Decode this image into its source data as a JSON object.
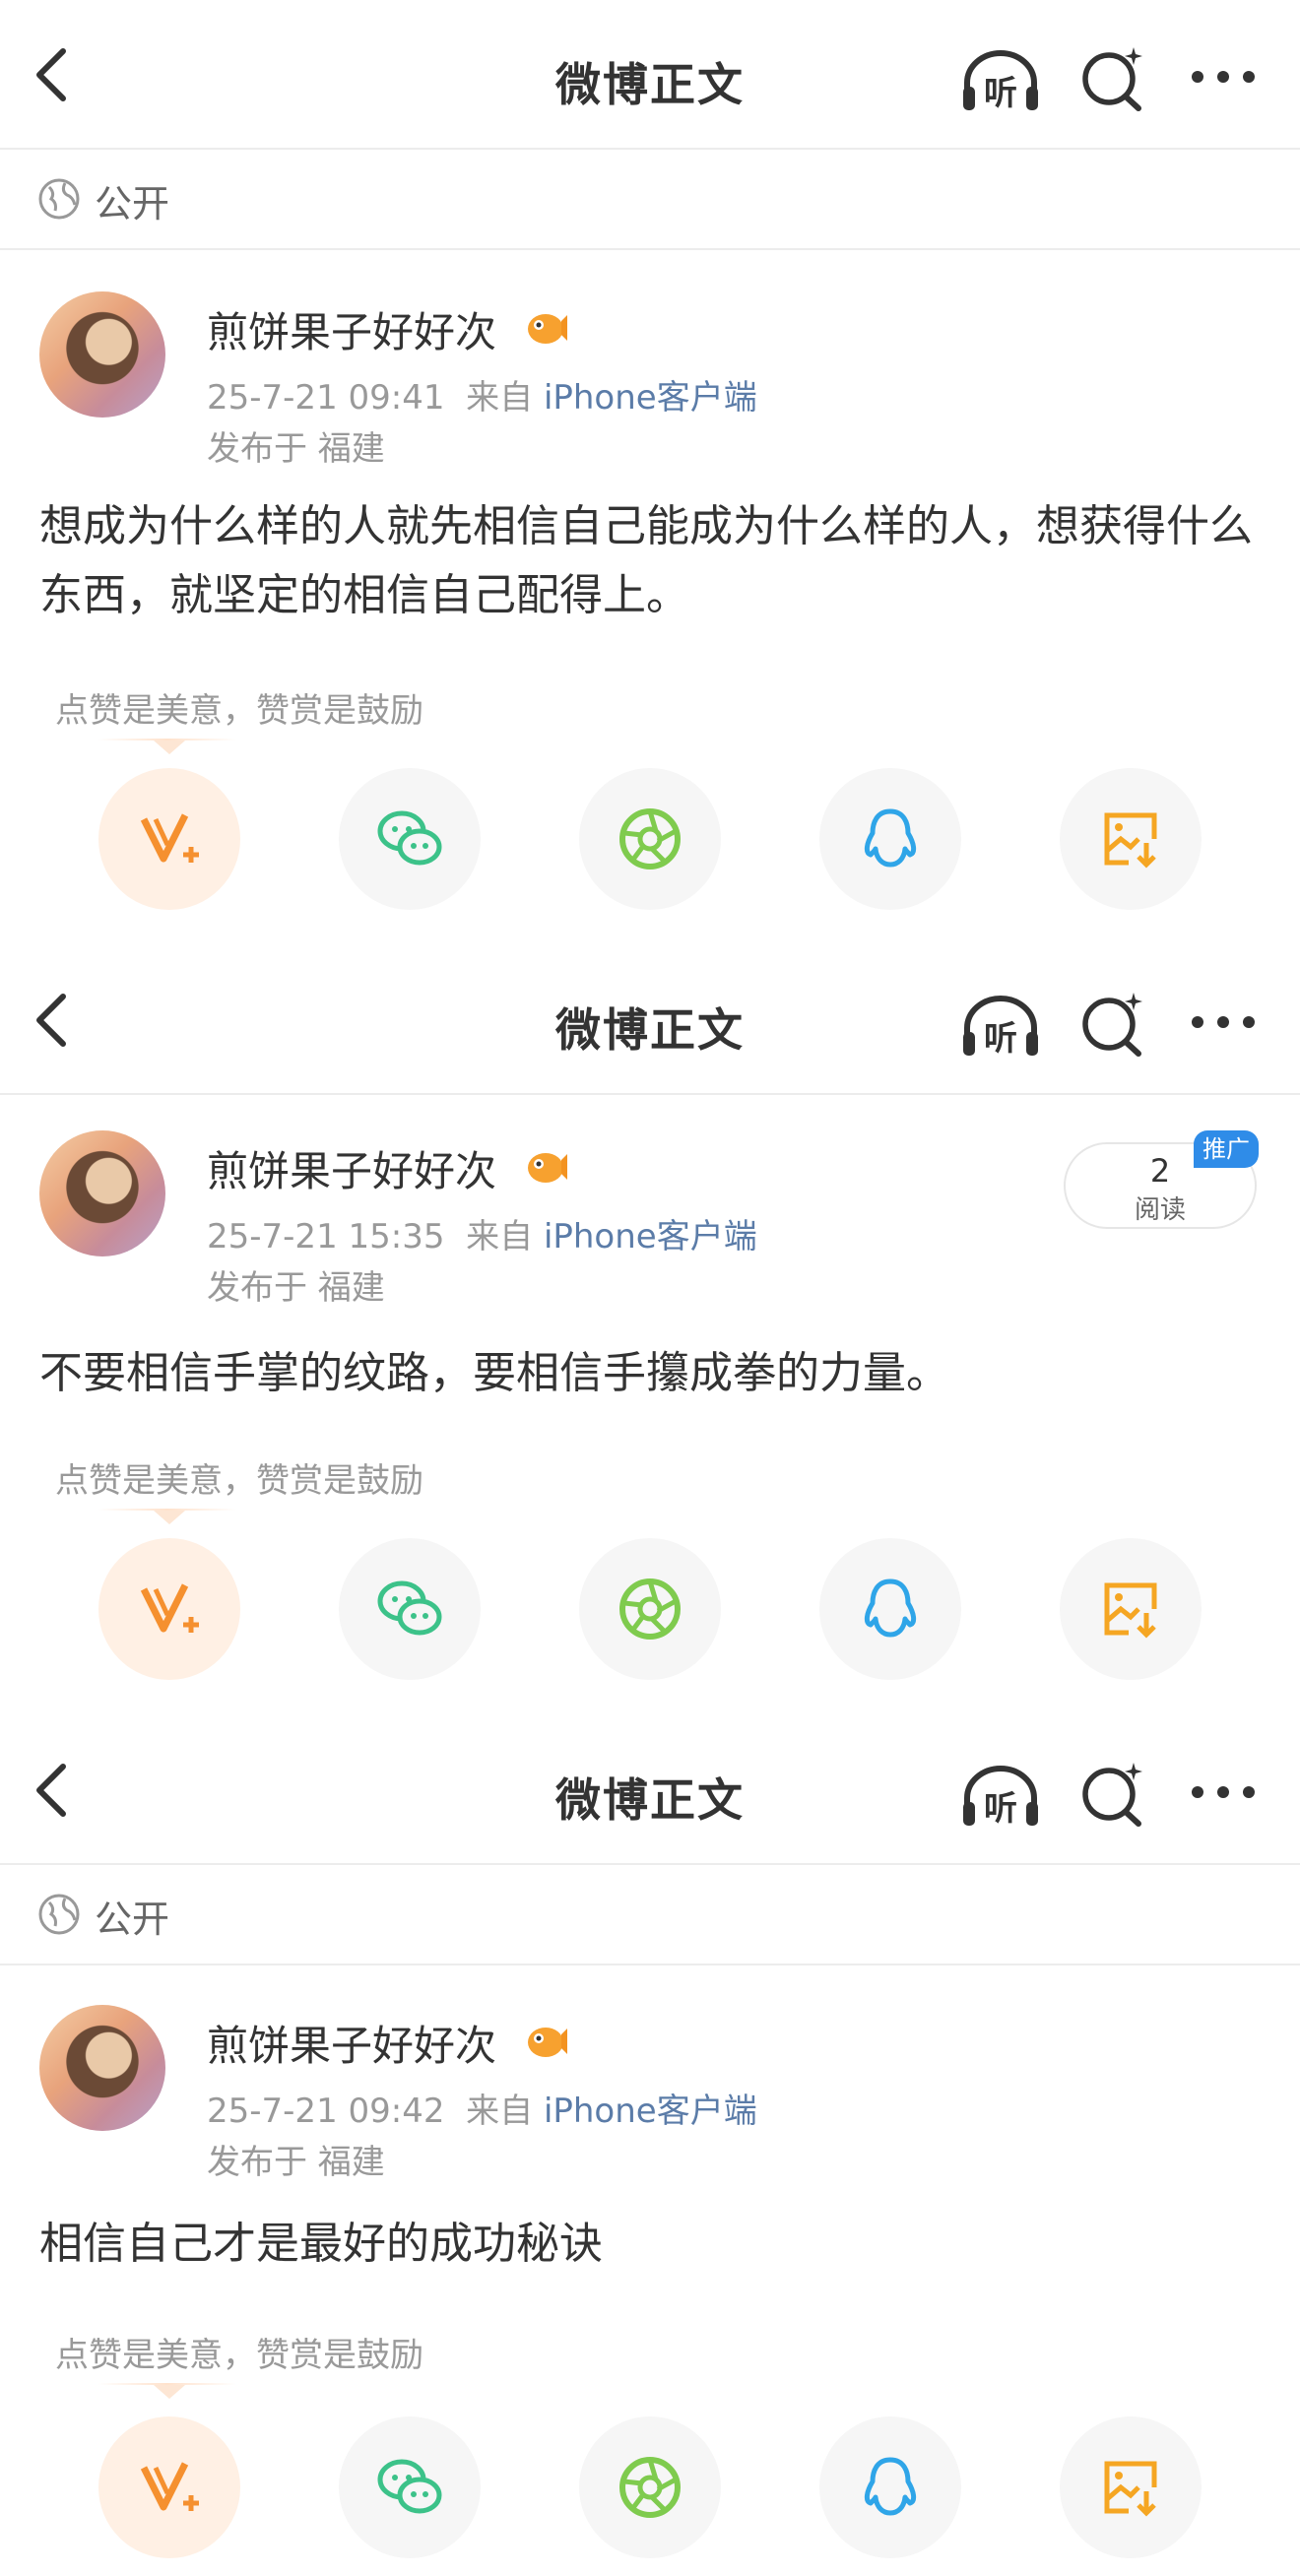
{
  "header": {
    "title": "微博正文",
    "listen_label": "听"
  },
  "visibility": {
    "label": "公开"
  },
  "share_tip": "点赞是美意，赞赏是鼓励",
  "share_buttons": [
    "reward",
    "wechat",
    "moments",
    "qq",
    "save-image"
  ],
  "posts": [
    {
      "user": {
        "name": "煎饼果子好好次"
      },
      "time": "25-7-21 09:41",
      "source_prefix": "来自",
      "source": "iPhone客户端",
      "location": "发布于 福建",
      "text": "想成为什么样的人就先相信自己能成为什么样的人，想获得什么东西，就坚定的相信自己配得上。"
    },
    {
      "user": {
        "name": "煎饼果子好好次"
      },
      "time": "25-7-21 15:35",
      "source_prefix": "来自",
      "source": "iPhone客户端",
      "location": "发布于 福建",
      "text": "不要相信手掌的纹路，要相信手攥成拳的力量。",
      "reads": {
        "count": "2",
        "label": "阅读",
        "promo": "推广"
      }
    },
    {
      "user": {
        "name": "煎饼果子好好次"
      },
      "time": "25-7-21 09:42",
      "source_prefix": "来自",
      "source": "iPhone客户端",
      "location": "发布于 福建",
      "text": "相信自己才是最好的成功秘诀"
    }
  ],
  "colors": {
    "accent_orange": "#f5902f",
    "wechat_green": "#3cc289",
    "moments_green": "#7fcb4e",
    "qq_blue": "#2fa5e8",
    "link_blue": "#5b7ca8"
  }
}
